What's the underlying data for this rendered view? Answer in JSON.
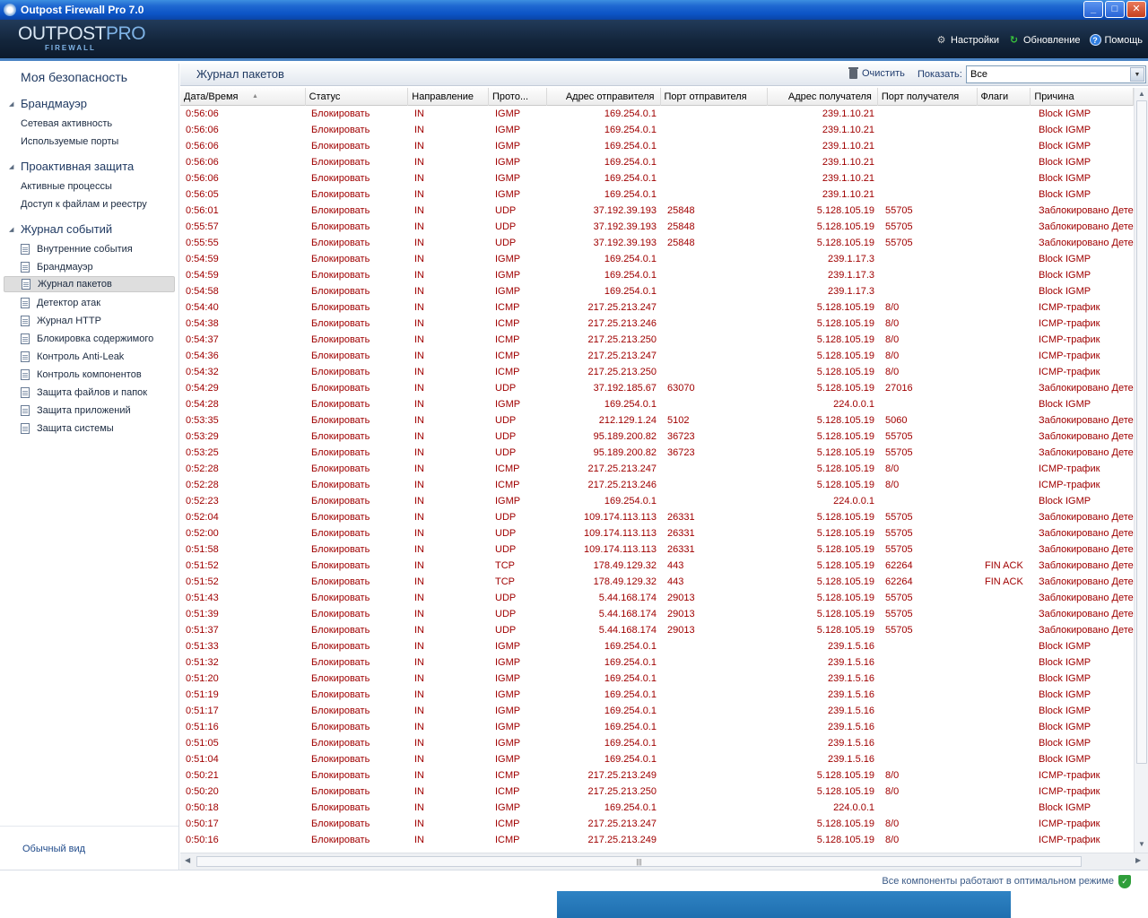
{
  "window": {
    "title": "Outpost Firewall Pro 7.0",
    "min": "_",
    "max": "□",
    "close": "✕"
  },
  "brand": {
    "line1_a": "OUTPOST",
    "line1_b": "PRO",
    "line2": "FIREWALL"
  },
  "header": {
    "settings": "Настройки",
    "update": "Обновление",
    "help": "Помощь"
  },
  "sidebar": {
    "title": "Моя безопасность",
    "firewall": {
      "label": "Брандмауэр",
      "items": [
        "Сетевая активность",
        "Используемые порты"
      ]
    },
    "proactive": {
      "label": "Проактивная защита",
      "items": [
        "Активные процессы",
        "Доступ к файлам и реестру"
      ]
    },
    "log": {
      "label": "Журнал событий",
      "items": [
        "Внутренние события",
        "Брандмауэр",
        "Журнал пакетов",
        "Детектор атак",
        "Журнал HTTP",
        "Блокировка содержимого",
        "Контроль Anti-Leak",
        "Контроль компонентов",
        "Защита файлов и папок",
        "Защита приложений",
        "Защита системы"
      ]
    },
    "footer": "Обычный вид"
  },
  "toolbar": {
    "title": "Журнал пакетов",
    "clear": "Очистить",
    "show_label": "Показать:",
    "show_value": "Все"
  },
  "table": {
    "columns": [
      "Дата/Время",
      "Статус",
      "Направление",
      "Прото...",
      "Адрес отправителя",
      "Порт отправителя",
      "Адрес получателя",
      "Порт получателя",
      "Флаги",
      "Причина"
    ],
    "rows": [
      [
        "0:56:06",
        "Блокировать",
        "IN",
        "IGMP",
        "169.254.0.1",
        "",
        "239.1.10.21",
        "",
        "",
        "Block IGMP"
      ],
      [
        "0:56:06",
        "Блокировать",
        "IN",
        "IGMP",
        "169.254.0.1",
        "",
        "239.1.10.21",
        "",
        "",
        "Block IGMP"
      ],
      [
        "0:56:06",
        "Блокировать",
        "IN",
        "IGMP",
        "169.254.0.1",
        "",
        "239.1.10.21",
        "",
        "",
        "Block IGMP"
      ],
      [
        "0:56:06",
        "Блокировать",
        "IN",
        "IGMP",
        "169.254.0.1",
        "",
        "239.1.10.21",
        "",
        "",
        "Block IGMP"
      ],
      [
        "0:56:06",
        "Блокировать",
        "IN",
        "IGMP",
        "169.254.0.1",
        "",
        "239.1.10.21",
        "",
        "",
        "Block IGMP"
      ],
      [
        "0:56:05",
        "Блокировать",
        "IN",
        "IGMP",
        "169.254.0.1",
        "",
        "239.1.10.21",
        "",
        "",
        "Block IGMP"
      ],
      [
        "0:56:01",
        "Блокировать",
        "IN",
        "UDP",
        "37.192.39.193",
        "25848",
        "5.128.105.19",
        "55705",
        "",
        "Заблокировано Детек"
      ],
      [
        "0:55:57",
        "Блокировать",
        "IN",
        "UDP",
        "37.192.39.193",
        "25848",
        "5.128.105.19",
        "55705",
        "",
        "Заблокировано Детек"
      ],
      [
        "0:55:55",
        "Блокировать",
        "IN",
        "UDP",
        "37.192.39.193",
        "25848",
        "5.128.105.19",
        "55705",
        "",
        "Заблокировано Детек"
      ],
      [
        "0:54:59",
        "Блокировать",
        "IN",
        "IGMP",
        "169.254.0.1",
        "",
        "239.1.17.3",
        "",
        "",
        "Block IGMP"
      ],
      [
        "0:54:59",
        "Блокировать",
        "IN",
        "IGMP",
        "169.254.0.1",
        "",
        "239.1.17.3",
        "",
        "",
        "Block IGMP"
      ],
      [
        "0:54:58",
        "Блокировать",
        "IN",
        "IGMP",
        "169.254.0.1",
        "",
        "239.1.17.3",
        "",
        "",
        "Block IGMP"
      ],
      [
        "0:54:40",
        "Блокировать",
        "IN",
        "ICMP",
        "217.25.213.247",
        "",
        "5.128.105.19",
        "8/0",
        "",
        "ICMP-трафик"
      ],
      [
        "0:54:38",
        "Блокировать",
        "IN",
        "ICMP",
        "217.25.213.246",
        "",
        "5.128.105.19",
        "8/0",
        "",
        "ICMP-трафик"
      ],
      [
        "0:54:37",
        "Блокировать",
        "IN",
        "ICMP",
        "217.25.213.250",
        "",
        "5.128.105.19",
        "8/0",
        "",
        "ICMP-трафик"
      ],
      [
        "0:54:36",
        "Блокировать",
        "IN",
        "ICMP",
        "217.25.213.247",
        "",
        "5.128.105.19",
        "8/0",
        "",
        "ICMP-трафик"
      ],
      [
        "0:54:32",
        "Блокировать",
        "IN",
        "ICMP",
        "217.25.213.250",
        "",
        "5.128.105.19",
        "8/0",
        "",
        "ICMP-трафик"
      ],
      [
        "0:54:29",
        "Блокировать",
        "IN",
        "UDP",
        "37.192.185.67",
        "63070",
        "5.128.105.19",
        "27016",
        "",
        "Заблокировано Детек"
      ],
      [
        "0:54:28",
        "Блокировать",
        "IN",
        "IGMP",
        "169.254.0.1",
        "",
        "224.0.0.1",
        "",
        "",
        "Block IGMP"
      ],
      [
        "0:53:35",
        "Блокировать",
        "IN",
        "UDP",
        "212.129.1.24",
        "5102",
        "5.128.105.19",
        "5060",
        "",
        "Заблокировано Детек"
      ],
      [
        "0:53:29",
        "Блокировать",
        "IN",
        "UDP",
        "95.189.200.82",
        "36723",
        "5.128.105.19",
        "55705",
        "",
        "Заблокировано Детек"
      ],
      [
        "0:53:25",
        "Блокировать",
        "IN",
        "UDP",
        "95.189.200.82",
        "36723",
        "5.128.105.19",
        "55705",
        "",
        "Заблокировано Детек"
      ],
      [
        "0:52:28",
        "Блокировать",
        "IN",
        "ICMP",
        "217.25.213.247",
        "",
        "5.128.105.19",
        "8/0",
        "",
        "ICMP-трафик"
      ],
      [
        "0:52:28",
        "Блокировать",
        "IN",
        "ICMP",
        "217.25.213.246",
        "",
        "5.128.105.19",
        "8/0",
        "",
        "ICMP-трафик"
      ],
      [
        "0:52:23",
        "Блокировать",
        "IN",
        "IGMP",
        "169.254.0.1",
        "",
        "224.0.0.1",
        "",
        "",
        "Block IGMP"
      ],
      [
        "0:52:04",
        "Блокировать",
        "IN",
        "UDP",
        "109.174.113.113",
        "26331",
        "5.128.105.19",
        "55705",
        "",
        "Заблокировано Детек"
      ],
      [
        "0:52:00",
        "Блокировать",
        "IN",
        "UDP",
        "109.174.113.113",
        "26331",
        "5.128.105.19",
        "55705",
        "",
        "Заблокировано Детек"
      ],
      [
        "0:51:58",
        "Блокировать",
        "IN",
        "UDP",
        "109.174.113.113",
        "26331",
        "5.128.105.19",
        "55705",
        "",
        "Заблокировано Детек"
      ],
      [
        "0:51:52",
        "Блокировать",
        "IN",
        "TCP",
        "178.49.129.32",
        "443",
        "5.128.105.19",
        "62264",
        "FIN ACK",
        "Заблокировано Детек"
      ],
      [
        "0:51:52",
        "Блокировать",
        "IN",
        "TCP",
        "178.49.129.32",
        "443",
        "5.128.105.19",
        "62264",
        "FIN ACK",
        "Заблокировано Детек"
      ],
      [
        "0:51:43",
        "Блокировать",
        "IN",
        "UDP",
        "5.44.168.174",
        "29013",
        "5.128.105.19",
        "55705",
        "",
        "Заблокировано Детек"
      ],
      [
        "0:51:39",
        "Блокировать",
        "IN",
        "UDP",
        "5.44.168.174",
        "29013",
        "5.128.105.19",
        "55705",
        "",
        "Заблокировано Детек"
      ],
      [
        "0:51:37",
        "Блокировать",
        "IN",
        "UDP",
        "5.44.168.174",
        "29013",
        "5.128.105.19",
        "55705",
        "",
        "Заблокировано Детек"
      ],
      [
        "0:51:33",
        "Блокировать",
        "IN",
        "IGMP",
        "169.254.0.1",
        "",
        "239.1.5.16",
        "",
        "",
        "Block IGMP"
      ],
      [
        "0:51:32",
        "Блокировать",
        "IN",
        "IGMP",
        "169.254.0.1",
        "",
        "239.1.5.16",
        "",
        "",
        "Block IGMP"
      ],
      [
        "0:51:20",
        "Блокировать",
        "IN",
        "IGMP",
        "169.254.0.1",
        "",
        "239.1.5.16",
        "",
        "",
        "Block IGMP"
      ],
      [
        "0:51:19",
        "Блокировать",
        "IN",
        "IGMP",
        "169.254.0.1",
        "",
        "239.1.5.16",
        "",
        "",
        "Block IGMP"
      ],
      [
        "0:51:17",
        "Блокировать",
        "IN",
        "IGMP",
        "169.254.0.1",
        "",
        "239.1.5.16",
        "",
        "",
        "Block IGMP"
      ],
      [
        "0:51:16",
        "Блокировать",
        "IN",
        "IGMP",
        "169.254.0.1",
        "",
        "239.1.5.16",
        "",
        "",
        "Block IGMP"
      ],
      [
        "0:51:05",
        "Блокировать",
        "IN",
        "IGMP",
        "169.254.0.1",
        "",
        "239.1.5.16",
        "",
        "",
        "Block IGMP"
      ],
      [
        "0:51:04",
        "Блокировать",
        "IN",
        "IGMP",
        "169.254.0.1",
        "",
        "239.1.5.16",
        "",
        "",
        "Block IGMP"
      ],
      [
        "0:50:21",
        "Блокировать",
        "IN",
        "ICMP",
        "217.25.213.249",
        "",
        "5.128.105.19",
        "8/0",
        "",
        "ICMP-трафик"
      ],
      [
        "0:50:20",
        "Блокировать",
        "IN",
        "ICMP",
        "217.25.213.250",
        "",
        "5.128.105.19",
        "8/0",
        "",
        "ICMP-трафик"
      ],
      [
        "0:50:18",
        "Блокировать",
        "IN",
        "IGMP",
        "169.254.0.1",
        "",
        "224.0.0.1",
        "",
        "",
        "Block IGMP"
      ],
      [
        "0:50:17",
        "Блокировать",
        "IN",
        "ICMP",
        "217.25.213.247",
        "",
        "5.128.105.19",
        "8/0",
        "",
        "ICMP-трафик"
      ],
      [
        "0:50:16",
        "Блокировать",
        "IN",
        "ICMP",
        "217.25.213.249",
        "",
        "5.128.105.19",
        "8/0",
        "",
        "ICMP-трафик"
      ]
    ]
  },
  "status": {
    "text": "Все компоненты работают в оптимальном режиме"
  },
  "colors": {
    "accent": "#203a62",
    "log_text": "#a00000",
    "title_bar": "#0c54c6"
  }
}
